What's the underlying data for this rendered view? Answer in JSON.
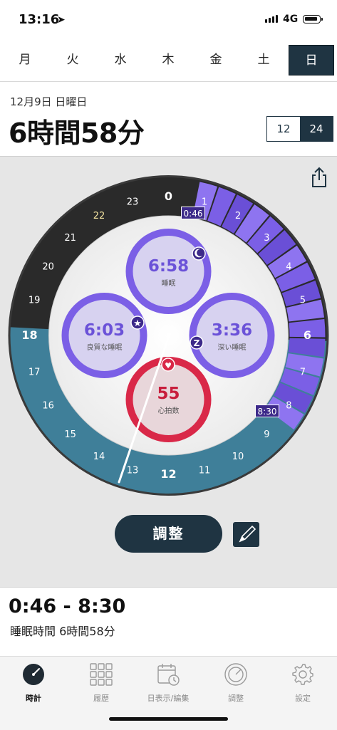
{
  "status_bar": {
    "time": "13:16",
    "network": "4G"
  },
  "weekdays": [
    {
      "label": "月",
      "active": false
    },
    {
      "label": "火",
      "active": false
    },
    {
      "label": "水",
      "active": false
    },
    {
      "label": "木",
      "active": false
    },
    {
      "label": "金",
      "active": false
    },
    {
      "label": "土",
      "active": false
    },
    {
      "label": "日",
      "active": true
    }
  ],
  "header": {
    "date": "12月9日 日曜日",
    "duration": "6時間58分",
    "format_toggle": {
      "option_12": "12",
      "option_24": "24",
      "selected": "24"
    }
  },
  "clock": {
    "hours": [
      "0",
      "1",
      "2",
      "3",
      "4",
      "5",
      "6",
      "7",
      "8",
      "9",
      "10",
      "11",
      "12",
      "13",
      "14",
      "15",
      "16",
      "17",
      "18",
      "19",
      "20",
      "21",
      "22",
      "23"
    ],
    "sleep_start": "0:46",
    "sleep_end": "8:30",
    "stats": {
      "sleep": {
        "value": "6:58",
        "label": "睡眠"
      },
      "quality": {
        "value": "6:03",
        "label": "良質な睡眠"
      },
      "deep": {
        "value": "3:36",
        "label": "深い睡眠"
      },
      "heart": {
        "value": "55",
        "label": "心拍数"
      }
    },
    "colors": {
      "sleep_band": "#7b5fe6",
      "daylight_band": "#3f7f99",
      "night_band": "#2a2a2a",
      "heart": "#d92848",
      "accent": "#1f3442"
    }
  },
  "actions": {
    "adjust_label": "調整"
  },
  "summary": {
    "range": "0:46 - 8:30",
    "sleep_time": "睡眠時間 6時間58分"
  },
  "tabbar": [
    {
      "label": "時計",
      "icon": "clock-icon",
      "active": true
    },
    {
      "label": "履歴",
      "icon": "grid-icon",
      "active": false
    },
    {
      "label": "日表示/編集",
      "icon": "calendar-icon",
      "active": false
    },
    {
      "label": "調整",
      "icon": "gauge-icon",
      "active": false
    },
    {
      "label": "設定",
      "icon": "gear-icon",
      "active": false
    }
  ]
}
